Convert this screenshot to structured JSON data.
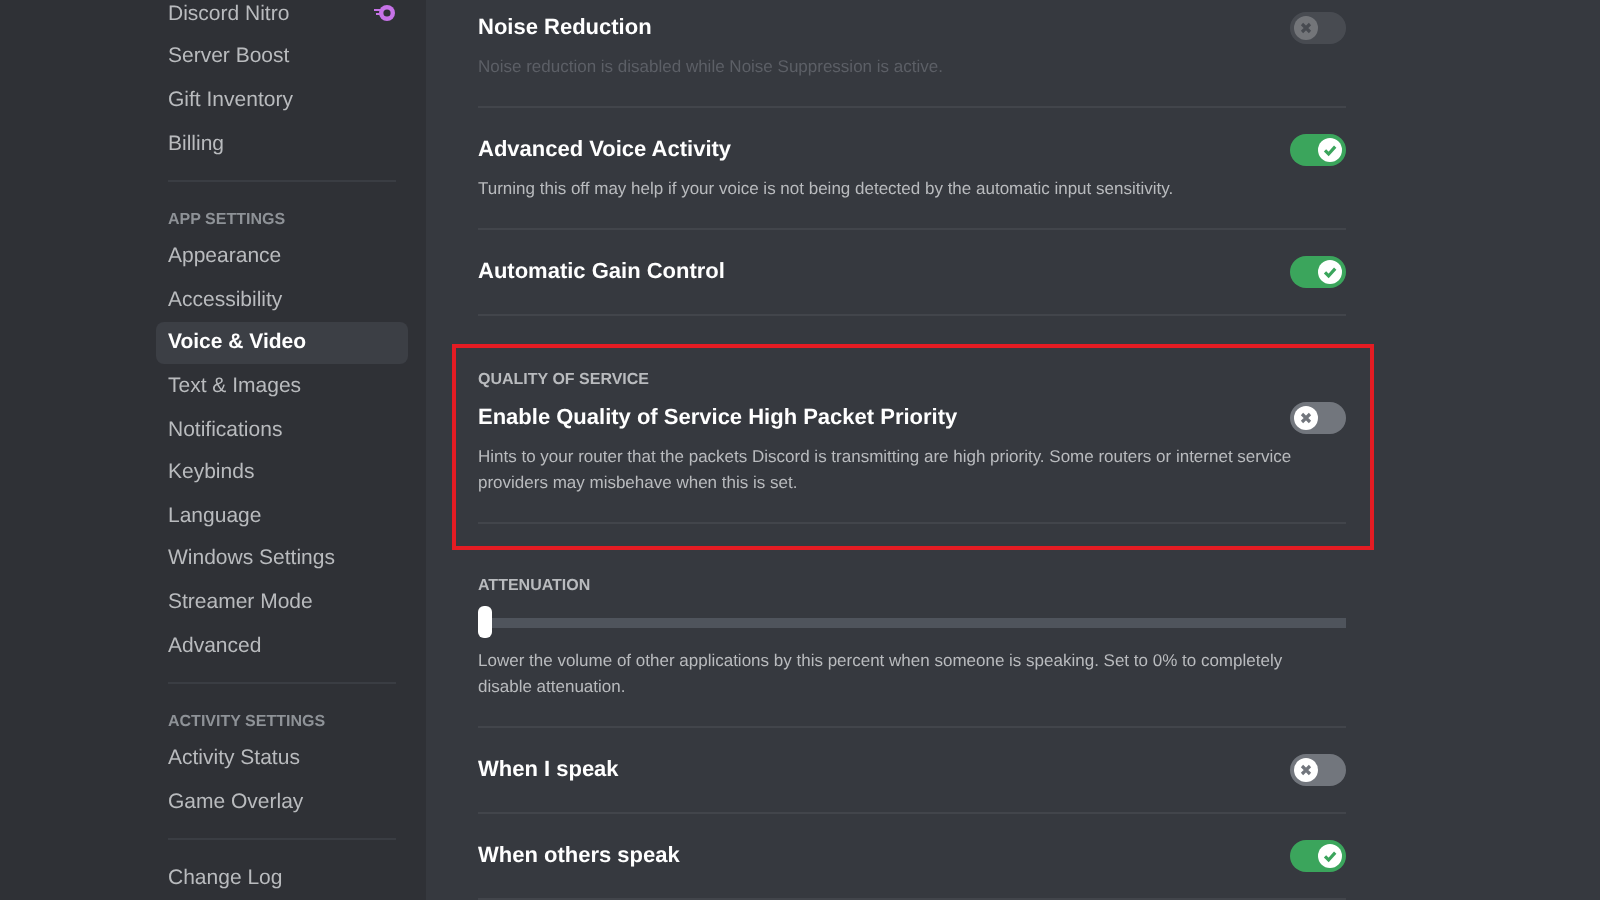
{
  "sidebar": {
    "items": [
      {
        "kind": "item",
        "label": "Discord Nitro",
        "selected": false,
        "badge": true
      },
      {
        "kind": "item",
        "label": "Server Boost",
        "selected": false
      },
      {
        "kind": "item",
        "label": "Gift Inventory",
        "selected": false
      },
      {
        "kind": "item",
        "label": "Billing",
        "selected": false
      },
      {
        "kind": "divider"
      },
      {
        "kind": "header",
        "label": "APP SETTINGS"
      },
      {
        "kind": "item",
        "label": "Appearance",
        "selected": false
      },
      {
        "kind": "item",
        "label": "Accessibility",
        "selected": false
      },
      {
        "kind": "item",
        "label": "Voice & Video",
        "selected": true
      },
      {
        "kind": "item",
        "label": "Text & Images",
        "selected": false
      },
      {
        "kind": "item",
        "label": "Notifications",
        "selected": false
      },
      {
        "kind": "item",
        "label": "Keybinds",
        "selected": false
      },
      {
        "kind": "item",
        "label": "Language",
        "selected": false
      },
      {
        "kind": "item",
        "label": "Windows Settings",
        "selected": false
      },
      {
        "kind": "item",
        "label": "Streamer Mode",
        "selected": false
      },
      {
        "kind": "item",
        "label": "Advanced",
        "selected": false
      },
      {
        "kind": "divider"
      },
      {
        "kind": "header",
        "label": "ACTIVITY SETTINGS"
      },
      {
        "kind": "item",
        "label": "Activity Status",
        "selected": false
      },
      {
        "kind": "item",
        "label": "Game Overlay",
        "selected": false
      },
      {
        "kind": "divider"
      },
      {
        "kind": "item",
        "label": "Change Log",
        "selected": false
      }
    ]
  },
  "settings": [
    {
      "kind": "toggle",
      "title": "Noise Reduction",
      "description": "Noise reduction is disabled while Noise Suppression is active.",
      "on": false,
      "disabled": true,
      "highlighted": false
    },
    {
      "kind": "toggle",
      "title": "Advanced Voice Activity",
      "description": "Turning this off may help if your voice is not being detected by the automatic input sensitivity.",
      "on": true,
      "disabled": false,
      "highlighted": false
    },
    {
      "kind": "toggle",
      "title": "Automatic Gain Control",
      "on": true,
      "disabled": false,
      "highlighted": false
    },
    {
      "kind": "toggle",
      "header": "QUALITY OF SERVICE",
      "title": "Enable Quality of Service High Packet Priority",
      "description": "Hints to your router that the packets Discord is transmitting are high priority. Some routers or internet service providers may misbehave when this is set.",
      "on": false,
      "disabled": false,
      "highlighted": true
    },
    {
      "kind": "slider",
      "header": "ATTENUATION",
      "level": 0,
      "description": "Lower the volume of other applications by this percent when someone is speaking. Set to 0% to completely disable attenuation."
    },
    {
      "kind": "toggle",
      "title": "When I speak",
      "on": false,
      "disabled": false,
      "highlighted": false
    },
    {
      "kind": "toggle",
      "title": "When others speak",
      "on": true,
      "disabled": false,
      "highlighted": false
    }
  ]
}
